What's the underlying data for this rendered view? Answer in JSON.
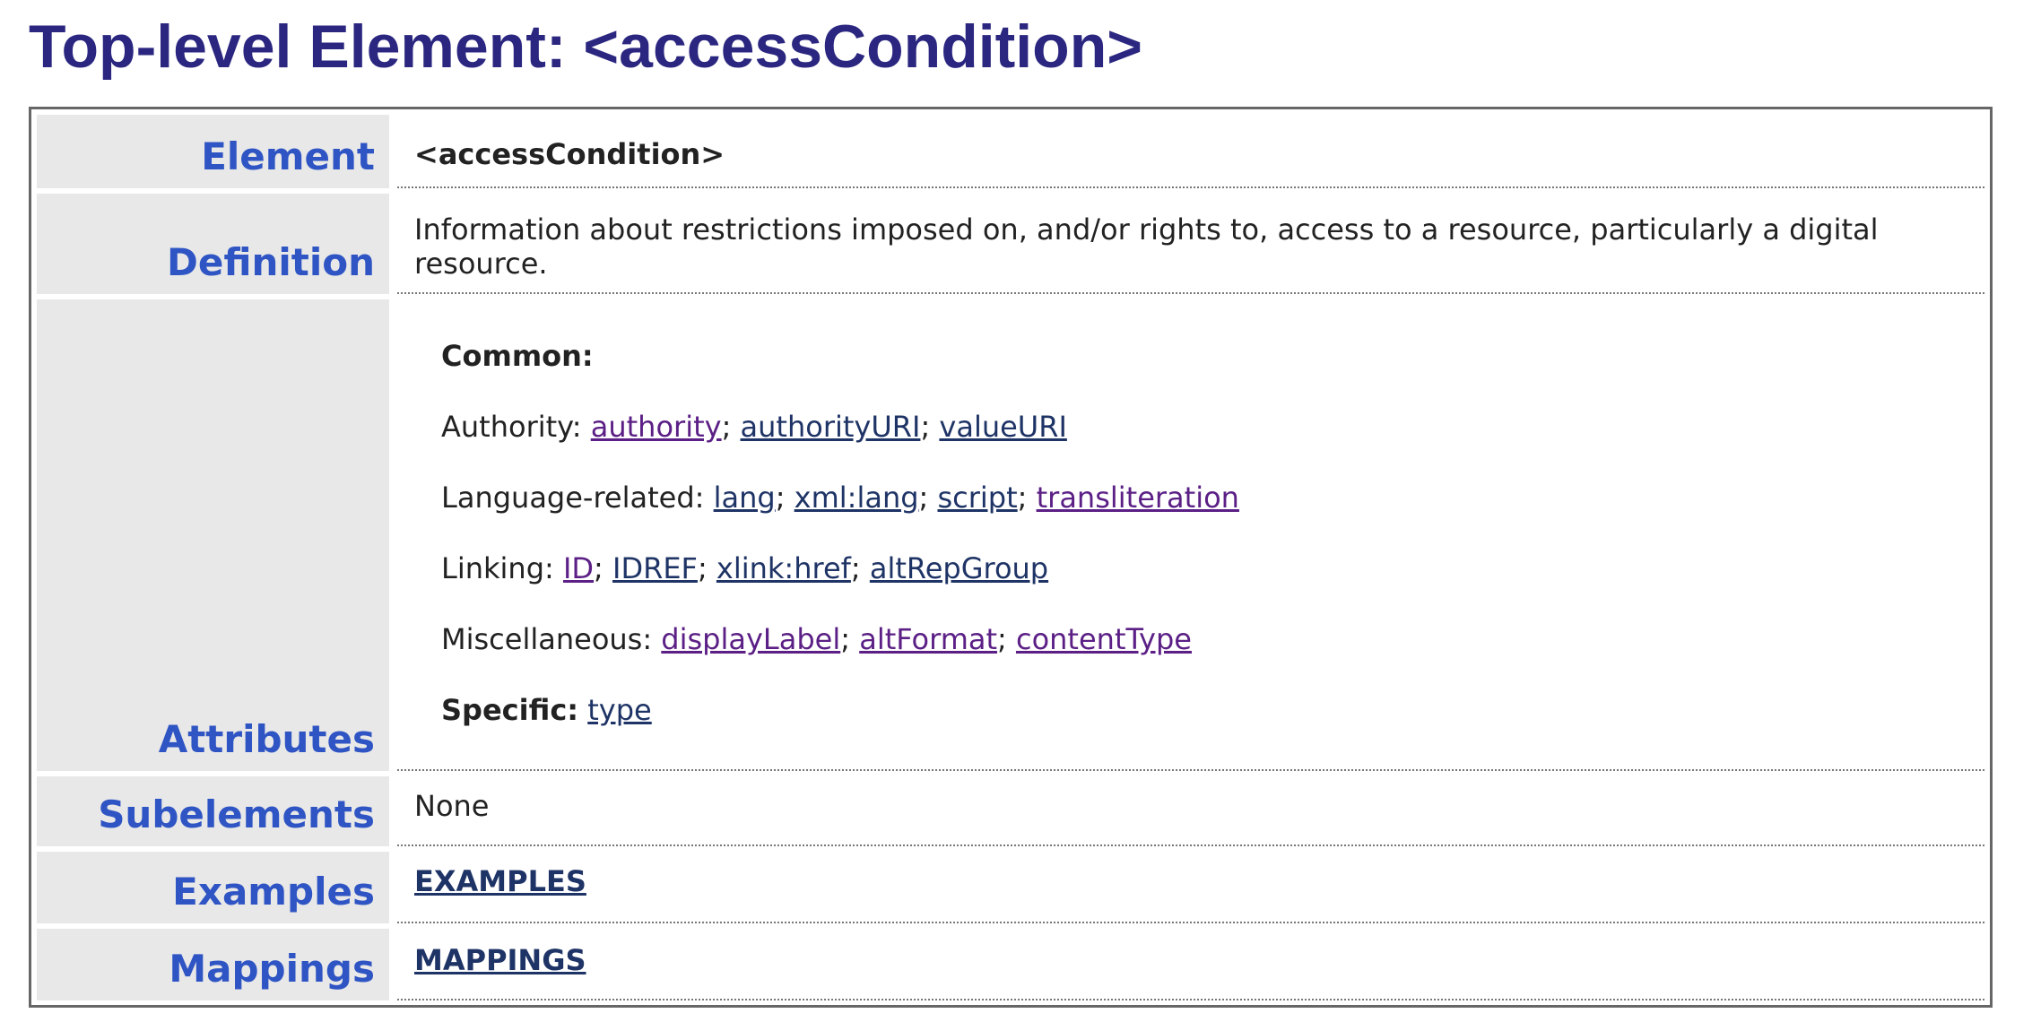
{
  "page": {
    "title": "Top-level Element: <accessCondition>"
  },
  "element_row": {
    "label": "Element",
    "value": "<accessCondition>"
  },
  "definition_row": {
    "label": "Definition",
    "line1": "Information about restrictions imposed on, and/or rights to, access to a resource, particularly a digital",
    "line2": "resource."
  },
  "attributes_row": {
    "label": "Attributes",
    "common_heading": "Common:",
    "authority": {
      "prefix": "Authority: ",
      "links": [
        "authority",
        "authorityURI",
        "valueURI"
      ]
    },
    "language": {
      "prefix": "Language-related: ",
      "links": [
        "lang",
        "xml:lang",
        "script",
        "transliteration"
      ]
    },
    "linking": {
      "prefix": "Linking: ",
      "links": [
        "ID",
        "IDREF",
        "xlink:href",
        "altRepGroup"
      ]
    },
    "misc": {
      "prefix": "Miscellaneous: ",
      "links": [
        "displayLabel",
        "altFormat",
        "contentType"
      ]
    },
    "specific": {
      "heading": "Specific:",
      "links": [
        "type"
      ]
    },
    "separator": "; "
  },
  "subelements_row": {
    "label": "Subelements",
    "value": "None"
  },
  "examples_row": {
    "label": "Examples",
    "link": "EXAMPLES"
  },
  "mappings_row": {
    "label": "Mappings",
    "link": "MAPPINGS"
  },
  "colors": {
    "title": "#2b2780",
    "label": "#2f55c4",
    "label_background": "#e8e8e8",
    "link": "#1f3466",
    "link_visited": "#5b1f85"
  }
}
